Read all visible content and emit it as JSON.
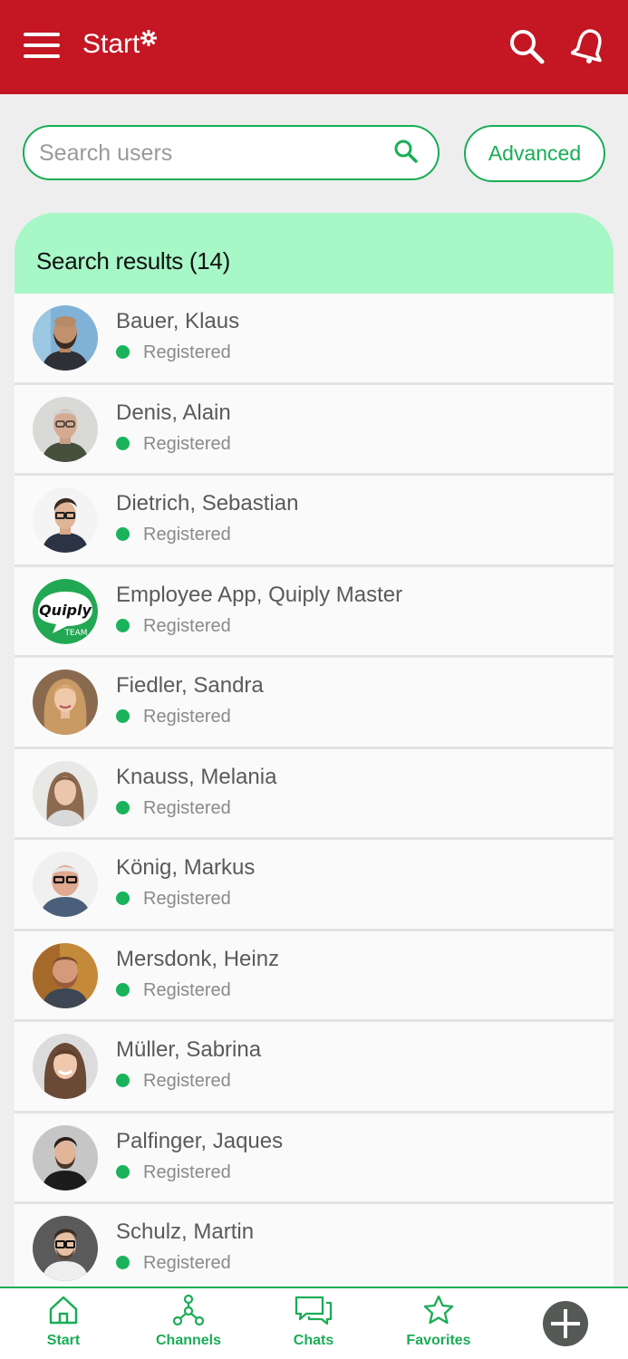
{
  "header": {
    "title": "Start",
    "bg_color": "#c41623"
  },
  "search": {
    "placeholder": "Search users",
    "value": "",
    "advanced_label": "Advanced"
  },
  "results": {
    "header": "Search results (14)",
    "items": [
      {
        "name": "Bauer, Klaus",
        "status": "Registered"
      },
      {
        "name": "Denis, Alain",
        "status": "Registered"
      },
      {
        "name": "Dietrich, Sebastian",
        "status": "Registered"
      },
      {
        "name": "Employee App, Quiply Master",
        "status": "Registered"
      },
      {
        "name": "Fiedler, Sandra",
        "status": "Registered"
      },
      {
        "name": "Knauss, Melania",
        "status": "Registered"
      },
      {
        "name": "König, Markus",
        "status": "Registered"
      },
      {
        "name": "Mersdonk, Heinz",
        "status": "Registered"
      },
      {
        "name": "Müller, Sabrina",
        "status": "Registered"
      },
      {
        "name": "Palfinger, Jaques",
        "status": "Registered"
      },
      {
        "name": "Schulz, Martin",
        "status": "Registered"
      }
    ]
  },
  "quiply_logo": {
    "word": "Quiply",
    "sub": "TEAM"
  },
  "nav": {
    "start": "Start",
    "channels": "Channels",
    "chats": "Chats",
    "favorites": "Favorites"
  },
  "colors": {
    "accent": "#1aad55",
    "header_bar": "#c41623",
    "results_header": "#a7f7c7",
    "status_registered": "#1ab35b"
  }
}
